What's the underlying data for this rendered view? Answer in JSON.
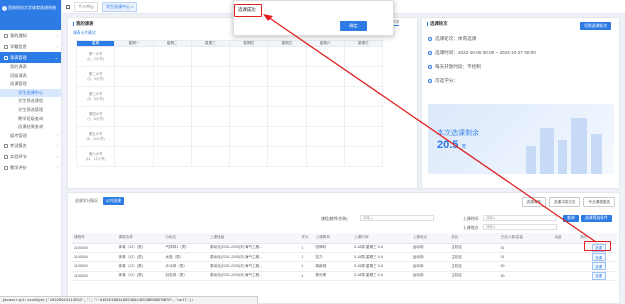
{
  "app": {
    "brand": "西南科技大学体育选课系统",
    "tabs": [
      {
        "label": "个人中心"
      },
      {
        "label": "学生选课中心 ×",
        "active": true
      }
    ]
  },
  "sidebar": {
    "items": [
      {
        "label": "我的通知"
      },
      {
        "label": "学籍信息"
      },
      {
        "label": "课表管理",
        "open": true
      },
      {
        "label": "我的课表",
        "level": 1
      },
      {
        "label": "班级课表",
        "level": 1
      },
      {
        "label": "选课管理",
        "level": 1
      },
      {
        "label": "学生选课中心",
        "level": 2,
        "active": true
      },
      {
        "label": "学生预选课程",
        "level": 2
      },
      {
        "label": "学生预选管理",
        "level": 2
      },
      {
        "label": "教学班级查询",
        "level": 2
      },
      {
        "label": "选课结果查询",
        "level": 2
      },
      {
        "label": "缓考管理",
        "level": 1
      },
      {
        "label": "考试报名"
      },
      {
        "label": "实验环节"
      },
      {
        "label": "教学评价"
      }
    ]
  },
  "schedule": {
    "title": "我的课表",
    "mode_link": "课表卡片模式",
    "week_tab": "本学",
    "days": [
      "星期",
      "星期一",
      "星期二",
      "星期三",
      "星期四",
      "星期五",
      "星期六",
      "星期日"
    ],
    "periods": [
      {
        "name": "第一大节",
        "time": "(1、2小节)"
      },
      {
        "name": "第二大节",
        "time": "(3、4小节)"
      },
      {
        "name": "第三大节",
        "time": "(5、6小节)"
      },
      {
        "name": "第四大节",
        "time": "(7、8小节)"
      },
      {
        "name": "第五大节",
        "time": "(9、10小节)"
      },
      {
        "name": "第六大节",
        "time": "(11、12小节)"
      }
    ]
  },
  "info": {
    "title": "选课轮次",
    "button": "切换选课轮次",
    "round": "选课轮次：体育选课",
    "time": "选课时间：2022-10-06 00:00 ~ 2022-10-27 00:00",
    "limit": "每天开放时段：不控制",
    "credit": "可选学分：",
    "banner_text": "本次选课剩余",
    "banner_days": "20.5",
    "banner_unit": "天"
  },
  "courses": {
    "tabs": [
      "选课学分情况",
      "公共选课"
    ],
    "buttons": [
      "选课清单",
      "选课冲突日志",
      "专业课程直选"
    ],
    "filters": {
      "course_label": "课程(教师/名称):",
      "course_placeholder": "请输入",
      "time_label": "上课时间:",
      "time_placeholder": "请输入",
      "place_label": "上课地点:",
      "place_placeholder": "请输入",
      "search": "查询",
      "filter_btn": "选课筛选条件"
    },
    "headers": [
      "课程号",
      "课程名称",
      "分组名",
      "上课班级",
      "学分",
      "上课教师",
      "上课时间",
      "上课地点",
      "校区",
      "已选人数/容量",
      "余量",
      "操作"
    ],
    "rows": [
      [
        "1100004",
        "体育（12）(男)",
        "气排球1（男）",
        "乘动化(2201-2205)刘,海气工程...",
        "1",
        "张锋科",
        "5-18周 星期三 5-6",
        "运动场",
        "主校区",
        "51",
        "",
        "选课"
      ],
      [
        "1100004",
        "体育（12）(男)",
        "太极（男）",
        "乘动化(2201-2205)刘,海气工程...",
        "1",
        "张力",
        "5-18周 星期三 5-6",
        "运动场",
        "主校区",
        "51",
        "",
        "选课"
      ],
      [
        "1100004",
        "体育（12）(男)",
        "乒乓球（男）",
        "乘动化(2201-2205)刘,海气工程...",
        "1",
        "蒋新城",
        "5-18周 星期三 5-6",
        "运动场",
        "主校区",
        "50",
        "",
        "选课"
      ],
      [
        "1100004",
        "体育（12）(男)",
        "羽毛球（男）",
        "乘动化(2201-2205)刘,海气工程...",
        "1",
        "杨光荣",
        "5-18周 星期三 5-6",
        "运动场",
        "主校区",
        "50",
        "",
        "选课"
      ]
    ]
  },
  "dialog": {
    "message": "选课成功",
    "ok": "确定"
  },
  "statusbar": "javascript:xsxkOper('20220923114533','','\\'94ECE4803109548924553BED6DFBB7D','null');",
  "colors": {
    "primary": "#2d7be5",
    "annotation": "#e02020"
  }
}
